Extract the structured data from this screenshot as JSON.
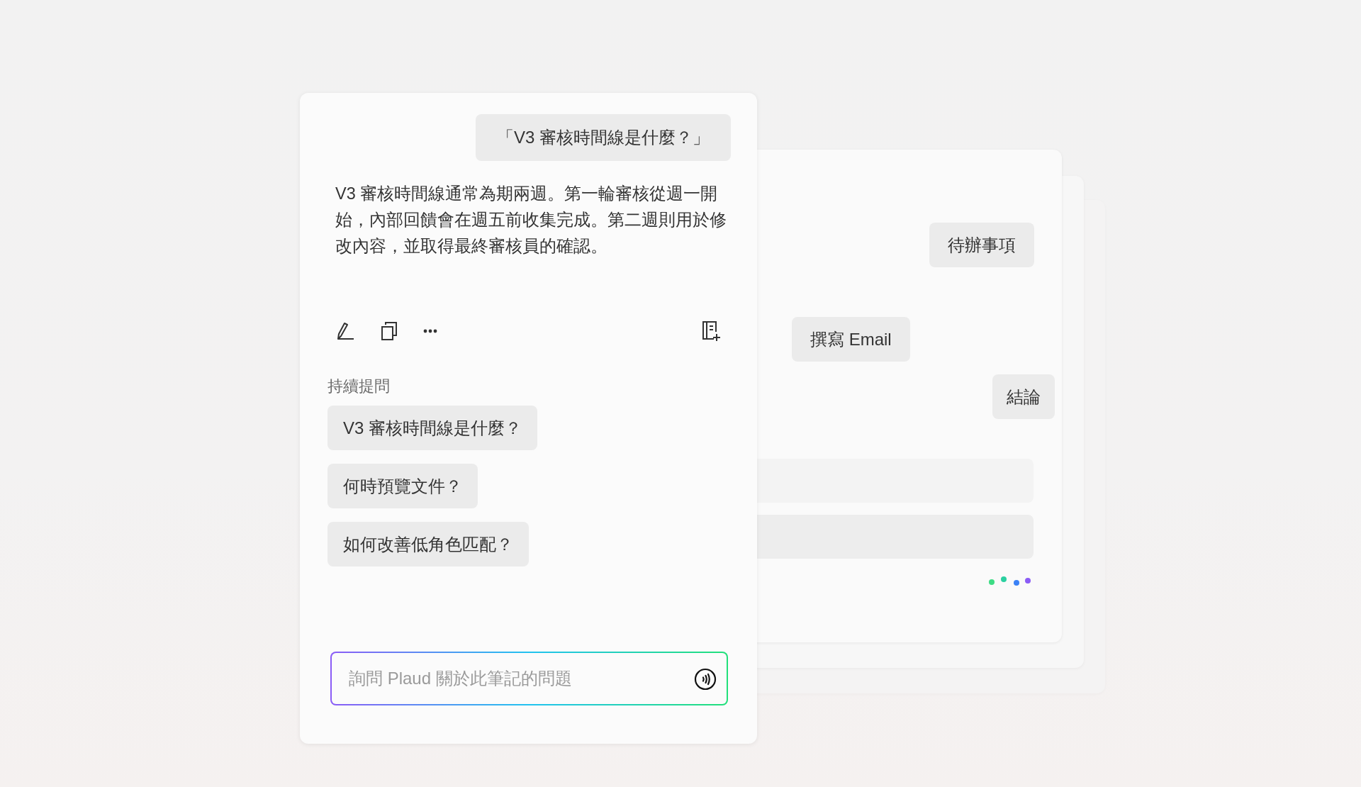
{
  "chat": {
    "question": "「V3 審核時間線是什麼？」",
    "answer": "V3 審核時間線通常為期兩週。第一輪審核從週一開始，內部回饋會在週五前收集完成。第二週則用於修改內容，並取得最終審核員的確認。",
    "follow_up": {
      "label": "持續提問",
      "suggestions": [
        "V3 審核時間線是什麼？",
        "何時預覽文件？",
        "如何改善低角色匹配？"
      ]
    },
    "input": {
      "placeholder": "詢問 Plaud 關於此筆記的問題"
    }
  },
  "back_card": {
    "chips": [
      {
        "label": "待辦事項"
      },
      {
        "label": "撰寫 Email"
      },
      {
        "label": "結論"
      }
    ]
  }
}
